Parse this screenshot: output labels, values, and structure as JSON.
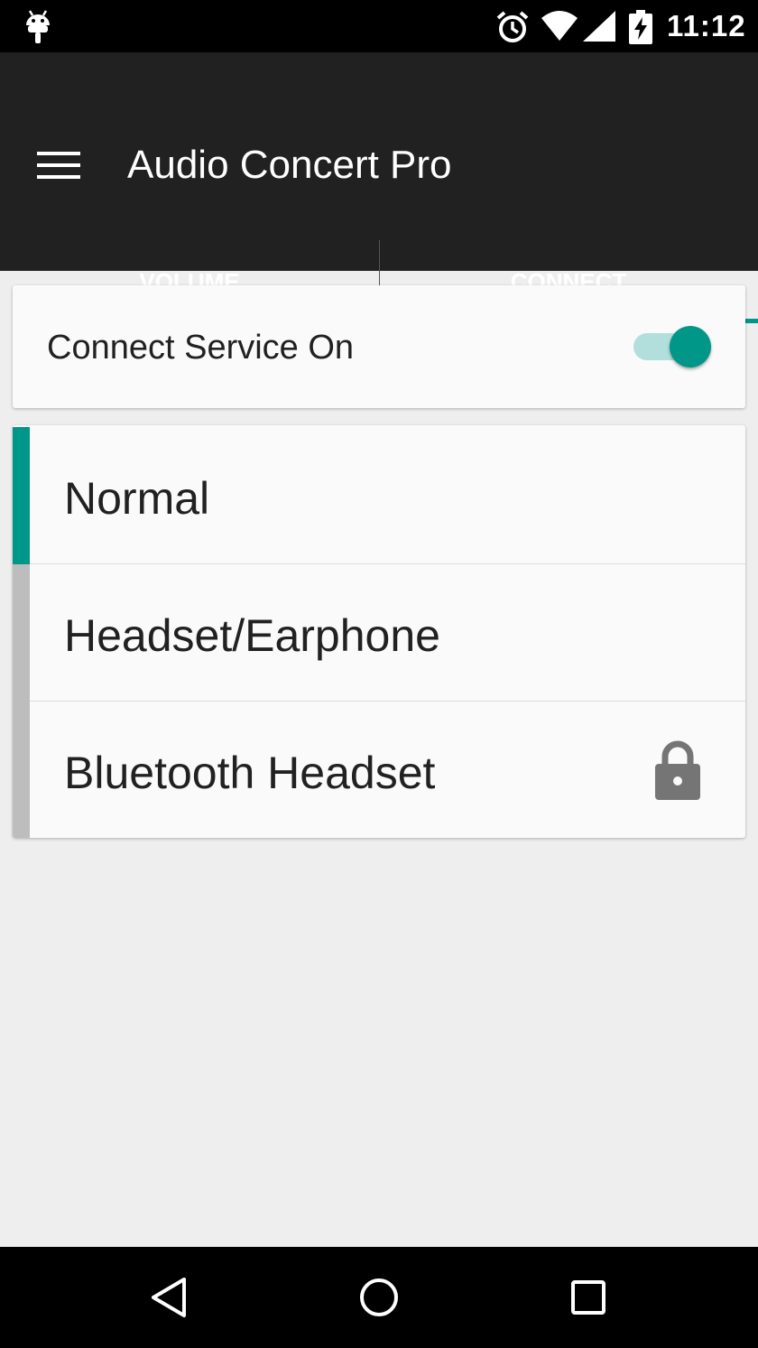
{
  "status_bar": {
    "time": "11:12",
    "icons": [
      "android-icon",
      "alarm-icon",
      "wifi-icon",
      "signal-icon",
      "battery-charging-icon"
    ]
  },
  "app_bar": {
    "title": "Audio Concert Pro",
    "menu_icon": "menu-icon"
  },
  "tabs": [
    {
      "label": "VOLUME",
      "selected": false
    },
    {
      "label": "CONNECT",
      "selected": true
    }
  ],
  "connect_service": {
    "label": "Connect Service On",
    "enabled": true
  },
  "modes": [
    {
      "label": "Normal",
      "active": true,
      "locked": false
    },
    {
      "label": "Headset/Earphone",
      "active": false,
      "locked": false
    },
    {
      "label": "Bluetooth Headset",
      "active": false,
      "locked": true
    }
  ],
  "navigation": {
    "icons": [
      "back-icon",
      "home-icon",
      "recent-apps-icon"
    ]
  },
  "colors": {
    "accent": "#009688",
    "accent_light": "#b2dfdb",
    "app_bar": "#212121",
    "inactive_bar": "#bdbdbd",
    "background": "#eeeeee"
  }
}
